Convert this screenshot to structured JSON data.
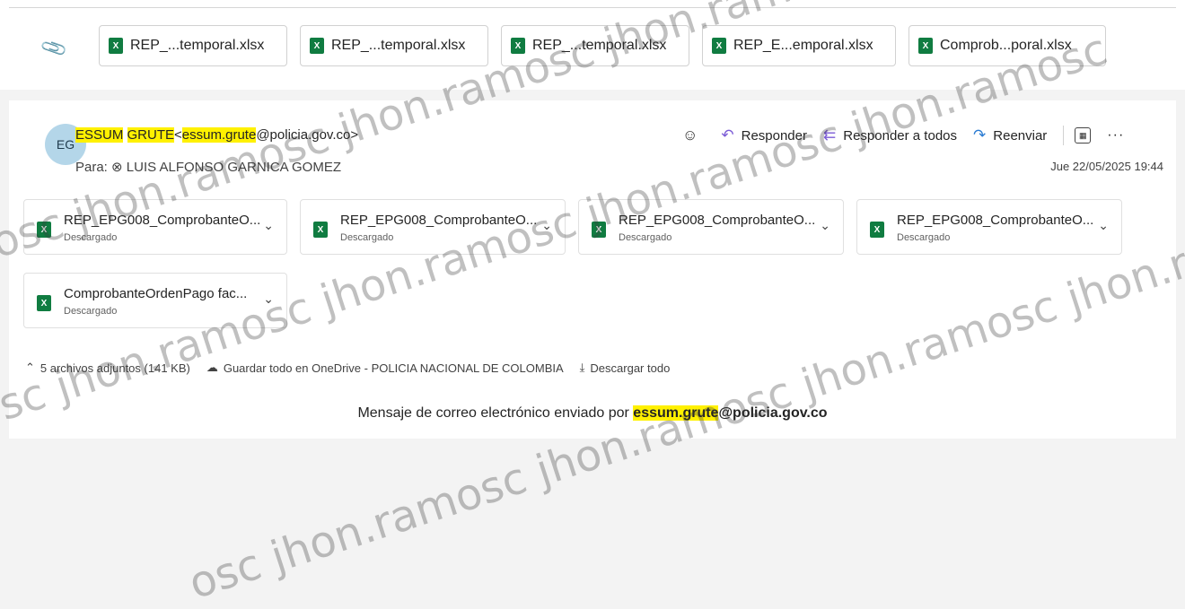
{
  "top_attachments": [
    {
      "label": "REP_...temporal.xlsx"
    },
    {
      "label": "REP_...temporal.xlsx"
    },
    {
      "label": "REP_...temporal.xlsx"
    },
    {
      "label": "REP_E...emporal.xlsx"
    },
    {
      "label": "Comprob...poral.xlsx"
    }
  ],
  "message": {
    "avatar_initials": "EG",
    "sender_name_part1": "ESSUM",
    "sender_name_part2": "GRUTE",
    "sender_email_user": "essum.grute",
    "sender_email_domain": "@policia.gov.co>",
    "to_label": "Para:",
    "to_recipient": "LUIS ALFONSO GARNICA GOMEZ",
    "date": "Jue 22/05/2025 19:44",
    "actions": {
      "reply": "Responder",
      "reply_all": "Responder a todos",
      "forward": "Reenviar"
    },
    "attachments": [
      {
        "name": "REP_EPG008_ComprobanteO...",
        "status": "Descargado"
      },
      {
        "name": "REP_EPG008_ComprobanteO...",
        "status": "Descargado"
      },
      {
        "name": "REP_EPG008_ComprobanteO...",
        "status": "Descargado"
      },
      {
        "name": "REP_EPG008_ComprobanteO...",
        "status": "Descargado"
      },
      {
        "name": "ComprobanteOrdenPago fac...",
        "status": "Descargado"
      }
    ],
    "footer": {
      "count": "5 archivos adjuntos (141 KB)",
      "save_onedrive": "Guardar todo en OneDrive - POLICIA NACIONAL DE COLOMBIA",
      "download_all": "Descargar todo"
    },
    "sent_prefix": "Mensaje de correo electrónico enviado por",
    "sent_user": "essum.grute",
    "sent_domain": "@policia.gov.co"
  },
  "watermark": "osc jhon.ramosc jhon.ramosc jhon.ramosc jhon.ramosc"
}
